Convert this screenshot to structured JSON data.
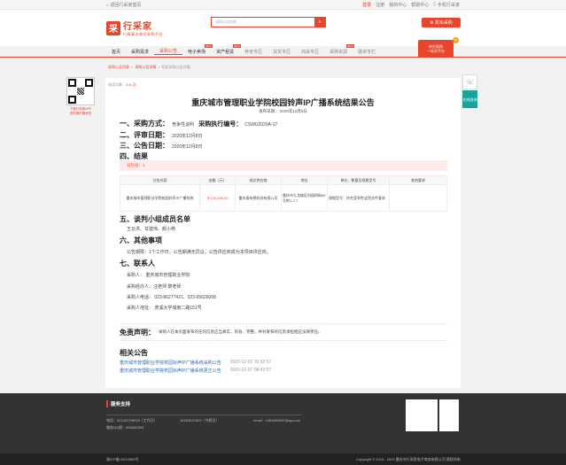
{
  "topbar": {
    "home_link": "返回行采家首页",
    "login": "登录",
    "register": "注册",
    "my_center": "我的中心",
    "help": "帮助中心",
    "mobile": "手机行采家"
  },
  "logo": {
    "box": "采",
    "name": "行采家",
    "slogan": "行政事业单位采购平台"
  },
  "search": {
    "placeholder": "采购公告名称"
  },
  "publish_button": "发布采购",
  "nav": [
    {
      "label": "首页",
      "new": ""
    },
    {
      "label": "采购需求",
      "new": ""
    },
    {
      "label": "采购公告",
      "new": ""
    },
    {
      "label": "电子卖场",
      "new": "NEW"
    },
    {
      "label": "资产租赁",
      "new": "NEW"
    },
    {
      "label": "养老专区",
      "new": ""
    },
    {
      "label": "扶贫专区",
      "new": ""
    },
    {
      "label": "商采专区",
      "new": ""
    },
    {
      "label": "采购资源",
      "new": "NEW"
    },
    {
      "label": "融资专栏",
      "new": ""
    }
  ],
  "promo": {
    "line1": "单位采购",
    "line2": "一站式平台",
    "hot": "热"
  },
  "breadcrumb": {
    "item1": "采购公告列表",
    "item2": "采购公告详情",
    "item3": "相关采购公告详情",
    "sep": ">"
  },
  "article": {
    "read_label": "阅读次数：",
    "read_count": "316 次",
    "title": "重庆城市管理职业学院校园铃声IP广播系统结果公告",
    "publish_date": "发布日期：  2020年12月8日",
    "sec1_label": "一、采购方式：",
    "sec1_method": "竞争性谈判",
    "sec1_code_label": "采购执行编号：",
    "sec1_code": "CSWU2020A-17",
    "sec2_label": "二、评审日期：",
    "sec2_value": "2020年12月8日",
    "sec3_label": "三、公告日期：",
    "sec3_value": "2020年12月8日",
    "sec4_label": "四、结果",
    "package": "分包号：1",
    "table_headers": [
      "分包内容",
      "金额（元）",
      "成交供应商",
      "地址",
      "单价、数量及规格型号",
      "其他要求"
    ],
    "table_row": {
      "content": "重庆城市管理职业学院校园铃声IP广播系统",
      "amount": "￥140,000.00",
      "supplier": "重庆泰有德科技有限公司",
      "address": "重庆市九龙坡区科园四街65号附1-7-7",
      "spec": "规格型号：符合竞争性谈判文件要求",
      "other": ""
    },
    "sec5_label": "五、谈判小组成员名单",
    "sec5_value": "王云洪、甘建伟、颜小燕",
    "sec6_label": "六、其他事项",
    "sec6_value": "公告期限：1个工作日。公告期满无异议，公告供应商成为本项目供应商。",
    "sec7_label": "七、联系人",
    "contact_buyer": "采购人：  重庆城市管理职业学院",
    "contact_agent": "采购经办人：汪老师 黎老师",
    "contact_phone": "采购人电话：  023-86277421、023-65626068",
    "contact_address": "采购人地址：  虎溪大学城南二路151号",
    "disclaimer_label": "免责声明：",
    "disclaimer_text": "采购人在本页面发布的任何信息应当真实、有效、完整，并对发布的信息承担相应法律责任。",
    "related_label": "相关公告",
    "related": [
      {
        "title": "重庆城市管理职业学院校园铃声IP广播系统采购公告",
        "date": "2020-12-02 16:32:57"
      },
      {
        "title": "重庆城市管理职业学院校园铃声IP广播系统更正公告",
        "date": "2020-12-07 08:43:57"
      }
    ]
  },
  "qr_left": {
    "cap1": "下载行采家APP",
    "cap2": "采购随时随地查"
  },
  "rightbar": {
    "service": "在线咨询"
  },
  "footer": {
    "heading": "服务支持",
    "phone": "电话：023-62708018（工作日）",
    "mobile": "18183037823（节假日）",
    "email": "email：1481894987@qq.com",
    "qq": "服务QQ群：808483393",
    "copyright": "Copyright © 2015 - 2022  重庆市行采家电子商务有限公司  版权所有",
    "icp": "渝ICP备15012969号"
  }
}
